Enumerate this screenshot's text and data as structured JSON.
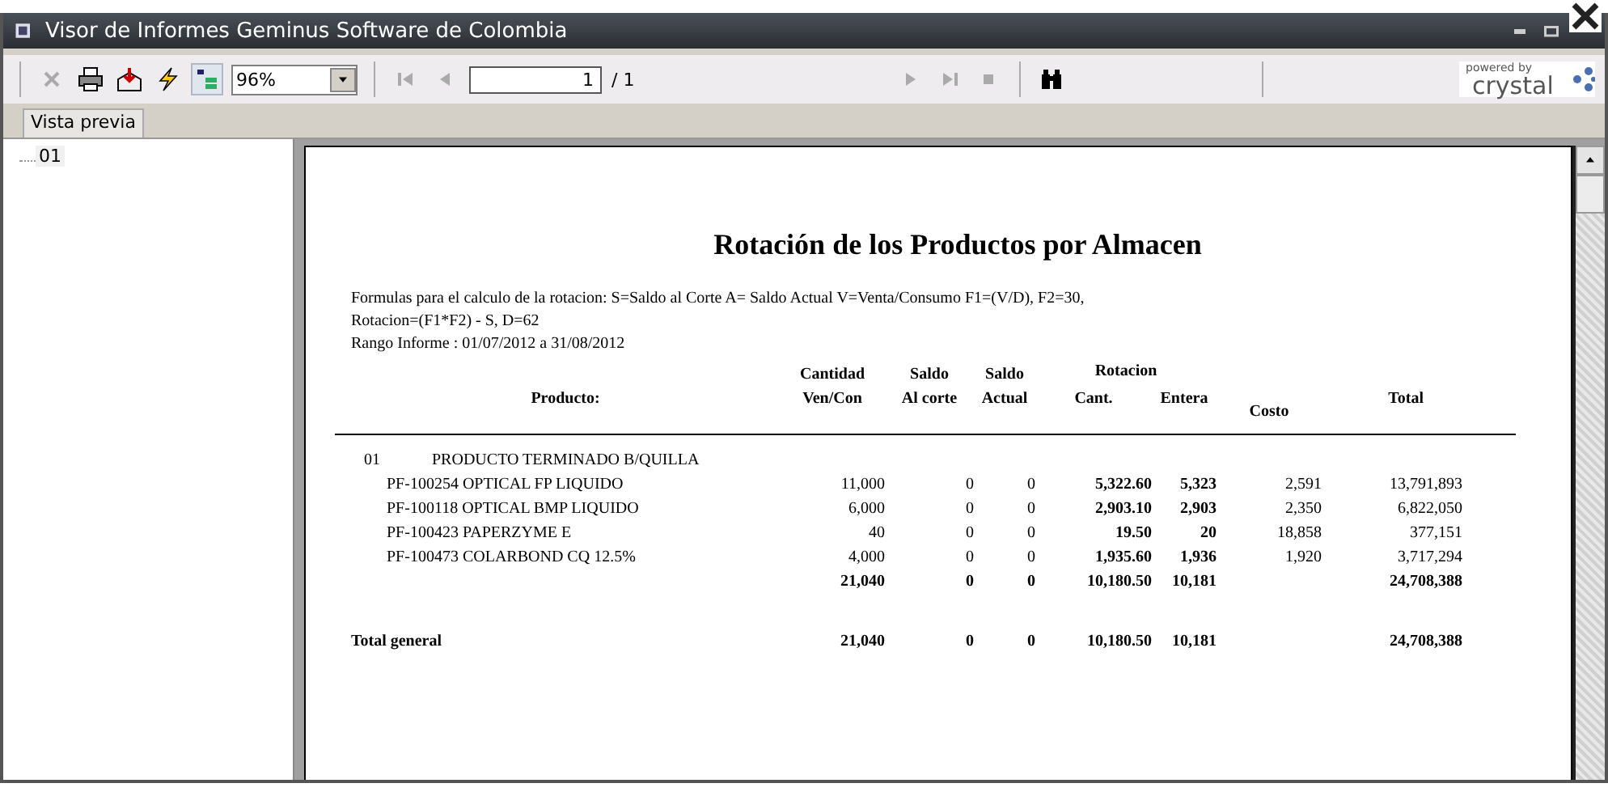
{
  "window": {
    "title": "Visor de Informes Geminus Software de Colombia"
  },
  "toolbar": {
    "zoom": "96%",
    "page": "1",
    "page_total": "/ 1",
    "tree_toggle_on": true,
    "logo": {
      "small": "powered by",
      "brand": "crystal"
    }
  },
  "tabs": [
    {
      "label": "Vista previa",
      "selected": true
    }
  ],
  "tree": {
    "items": [
      {
        "label": "01",
        "selected": false
      }
    ]
  },
  "report": {
    "title": "Rotación de los Productos por Almacen",
    "notes": [
      "Formulas para el calculo de la rotacion:  S=Saldo al Corte A= Saldo Actual  V=Venta/Consumo   F1=(V/D),    F2=30,",
      "Rotacion=(F1*F2) - S,    D=62",
      "Rango Informe : 01/07/2012 a 31/08/2012"
    ],
    "column_group": "Rotacion",
    "columns": [
      {
        "bottom": "Producto:"
      },
      {
        "top": "Cantidad",
        "bottom": "Ven/Con"
      },
      {
        "top": "Saldo",
        "bottom": "Al corte"
      },
      {
        "top": "Saldo",
        "bottom": "Actual"
      },
      {
        "bottom": "Cant."
      },
      {
        "bottom": "Entera"
      },
      {
        "bottom": "Costo"
      },
      {
        "bottom": "Total"
      }
    ],
    "group": {
      "code": "01",
      "name": "PRODUCTO TERMINADO B/QUILLA"
    },
    "rows": [
      {
        "kind": "item",
        "cells": [
          "PF-100254  OPTICAL FP LIQUIDO",
          "11,000",
          "0",
          "0",
          "5,322.60",
          "5,323",
          "2,591",
          "13,791,893"
        ]
      },
      {
        "kind": "item",
        "cells": [
          "PF-100118  OPTICAL BMP LIQUIDO",
          "6,000",
          "0",
          "0",
          "2,903.10",
          "2,903",
          "2,350",
          "6,822,050"
        ]
      },
      {
        "kind": "item",
        "cells": [
          "PF-100423  PAPERZYME E",
          "40",
          "0",
          "0",
          "19.50",
          "20",
          "18,858",
          "377,151"
        ]
      },
      {
        "kind": "item",
        "cells": [
          "PF-100473  COLARBOND CQ 12.5%",
          "4,000",
          "0",
          "0",
          "1,935.60",
          "1,936",
          "1,920",
          "3,717,294"
        ]
      },
      {
        "kind": "subtotal",
        "cells": [
          null,
          "21,040",
          "0",
          "0",
          "10,180.50",
          "10,181",
          null,
          "24,708,388"
        ]
      },
      {
        "kind": "grand",
        "cells": [
          "Total general",
          "21,040",
          "0",
          "0",
          "10,180.50",
          "10,181",
          null,
          "24,708,388"
        ]
      }
    ]
  }
}
